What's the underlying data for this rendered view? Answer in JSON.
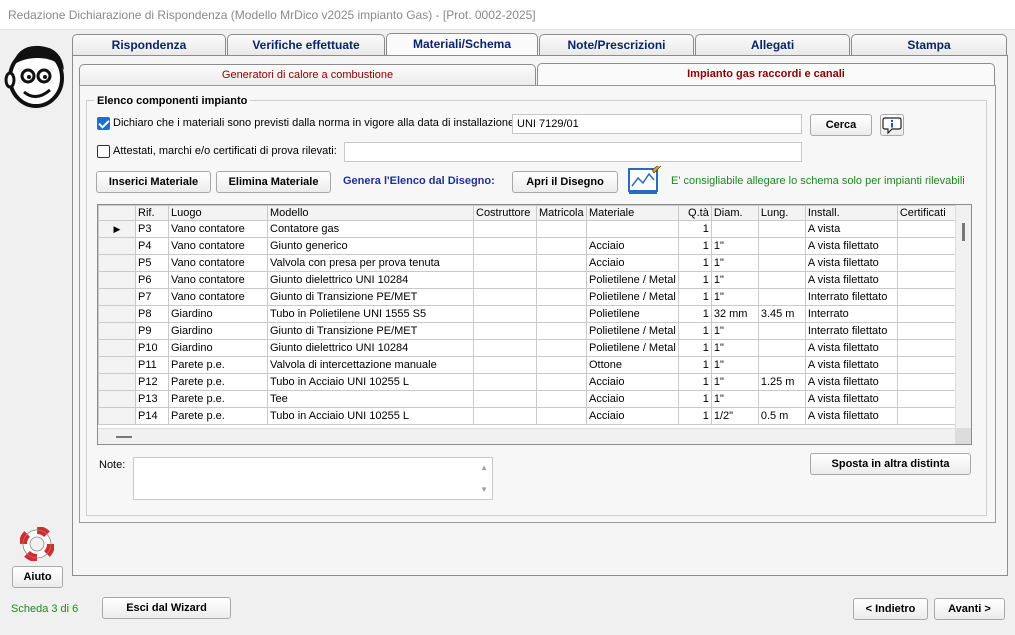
{
  "window": {
    "title": "Redazione Dichiarazione di Rispondenza (Modello MrDico v2025 impianto Gas) - [Prot. 0002-2025]"
  },
  "main_tabs": [
    "Rispondenza",
    "Verifiche effettuate",
    "Materiali/Schema",
    "Note/Prescrizioni",
    "Allegati",
    "Stampa"
  ],
  "sub_tabs": [
    "Generatori di calore a combustione",
    "Impianto gas raccordi e canali"
  ],
  "group_title": "Elenco componenti impianto",
  "declare": {
    "label": "Dichiaro che i materiali sono previsti dalla norma in vigore alla data di installazione:",
    "value": "UNI 7129/01",
    "search_label": "Cerca"
  },
  "certified": {
    "label": "Attestati, marchi e/o certificati di prova rilevati:",
    "value": ""
  },
  "toolbar": {
    "insert_label": "Inserici Materiale",
    "delete_label": "Elimina Materiale",
    "generate_label": "Genera l'Elenco dal Disegno:",
    "open_label": "Apri il Disegno",
    "hint": "E' consigliabile allegare lo schema solo per impianti rilevabili"
  },
  "table": {
    "columns": [
      "",
      "Rif.",
      "Luogo",
      "Modello",
      "Costruttore",
      "Matricola",
      "Materiale",
      "Q.tà",
      "Diam.",
      "Lung.",
      "Install.",
      "Certificati"
    ],
    "rows": [
      [
        "▶",
        "P3",
        "Vano contatore",
        "Contatore gas",
        "",
        "",
        "",
        "1",
        "",
        "",
        "A vista",
        ""
      ],
      [
        "",
        "P4",
        "Vano contatore",
        "Giunto generico",
        "",
        "",
        "Acciaio",
        "1",
        "1\"",
        "",
        "A vista filettato",
        ""
      ],
      [
        "",
        "P5",
        "Vano contatore",
        "Valvola con presa per prova tenuta",
        "",
        "",
        "Acciaio",
        "1",
        "1\"",
        "",
        "A vista filettato",
        ""
      ],
      [
        "",
        "P6",
        "Vano contatore",
        "Giunto dielettrico UNI 10284",
        "",
        "",
        "Polietilene / Metal",
        "1",
        "1\"",
        "",
        "A vista filettato",
        ""
      ],
      [
        "",
        "P7",
        "Vano contatore",
        "Giunto di Transizione PE/MET",
        "",
        "",
        "Polietilene / Metal",
        "1",
        "1\"",
        "",
        "Interrato filettato",
        ""
      ],
      [
        "",
        "P8",
        "Giardino",
        "Tubo in Polietilene UNI 1555 S5",
        "",
        "",
        "Polietilene",
        "1",
        "32 mm",
        "3.45 m",
        "Interrato",
        ""
      ],
      [
        "",
        "P9",
        "Giardino",
        "Giunto di Transizione PE/MET",
        "",
        "",
        "Polietilene / Metal",
        "1",
        "1\"",
        "",
        "Interrato filettato",
        ""
      ],
      [
        "",
        "P10",
        "Giardino",
        "Giunto dielettrico UNI 10284",
        "",
        "",
        "Polietilene / Metal",
        "1",
        "1\"",
        "",
        "A vista filettato",
        ""
      ],
      [
        "",
        "P11",
        "Parete p.e.",
        "Valvola di intercettazione manuale",
        "",
        "",
        "Ottone",
        "1",
        "1\"",
        "",
        "A vista filettato",
        ""
      ],
      [
        "",
        "P12",
        "Parete p.e.",
        "Tubo in Acciaio UNI 10255 L",
        "",
        "",
        "Acciaio",
        "1",
        "1\"",
        "1.25 m",
        "A vista filettato",
        ""
      ],
      [
        "",
        "P13",
        "Parete p.e.",
        "Tee",
        "",
        "",
        "Acciaio",
        "1",
        "1\"",
        "",
        "A vista filettato",
        ""
      ],
      [
        "",
        "P14",
        "Parete p.e.",
        "Tubo in Acciaio UNI 10255 L",
        "",
        "",
        "Acciaio",
        "1",
        "1/2\"",
        "0.5 m",
        "A vista filettato",
        ""
      ]
    ]
  },
  "notes": {
    "label": "Note:",
    "value": ""
  },
  "move_label": "Sposta in altra distinta",
  "help_label": "Aiuto",
  "footer": {
    "step": "Scheda 3 di 6",
    "exit_label": "Esci dal Wizard",
    "back_label": "< Indietro",
    "next_label": "Avanti >"
  },
  "colors": {
    "accent": "#1f2f9a",
    "tab_text": "#0a246a",
    "subtab_text": "#8b0000",
    "hint": "#1b8a1b",
    "step": "#1b8a1b",
    "checkbox": "#1a6fd1"
  },
  "icons": [
    "mascot-face-icon",
    "info-icon",
    "drawing-icon",
    "lifebuoy-icon",
    "row-pointer-icon"
  ]
}
